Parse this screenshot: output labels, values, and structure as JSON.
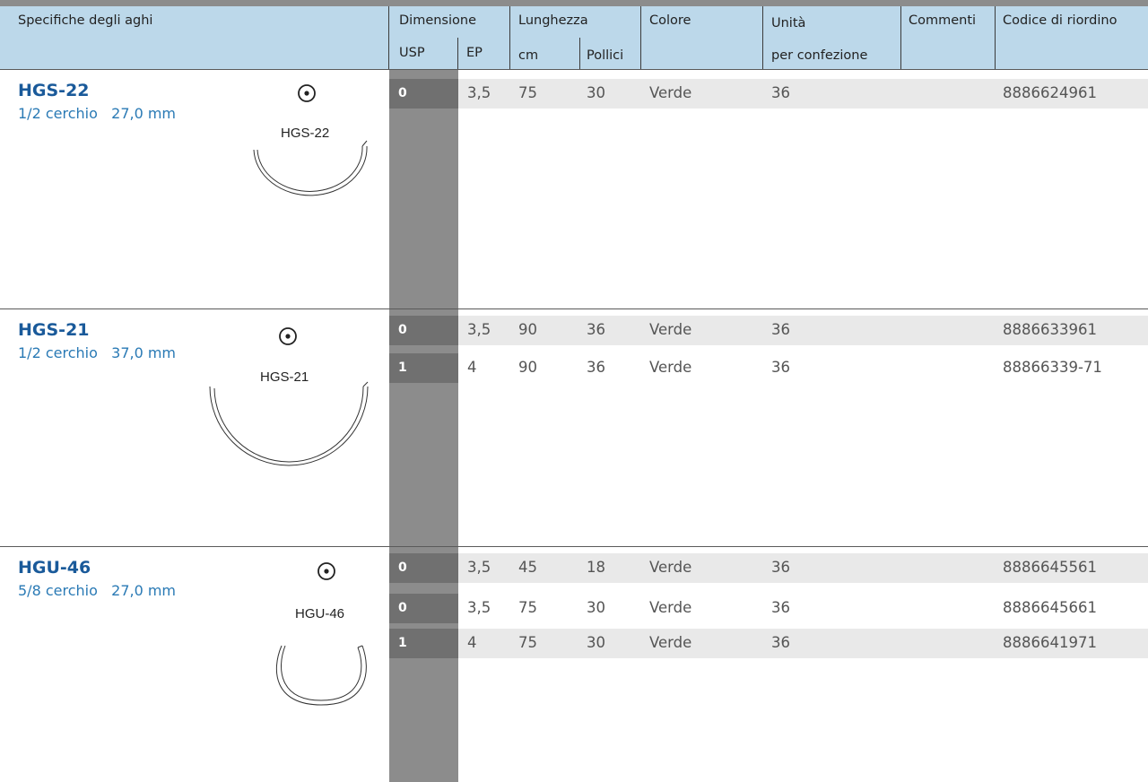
{
  "header": {
    "needle_spec": "Specifiche degli aghi",
    "size": "Dimensione",
    "usp": "USP",
    "ep": "EP",
    "length": "Lunghezza",
    "cm": "cm",
    "inches": "Pollici",
    "color": "Colore",
    "units": "Unità",
    "per_pack": "per confezione",
    "comments": "Commenti",
    "reorder_code": "Codice di riordino"
  },
  "groups": [
    {
      "name": "HGS-22",
      "spec": "1/2 cerchio   27,0 mm",
      "label": "HGS-22",
      "icon": "round-body-needle-icon",
      "curve": "1/2 circle",
      "rows": [
        {
          "usp": "0",
          "ep": "3,5",
          "cm": "75",
          "inches": "30",
          "color": "Verde",
          "units": "36",
          "comments": "",
          "code": "8886624961"
        }
      ]
    },
    {
      "name": "HGS-21",
      "spec": "1/2 cerchio   37,0 mm",
      "label": "HGS-21",
      "icon": "round-body-needle-icon",
      "curve": "1/2 circle",
      "rows": [
        {
          "usp": "0",
          "ep": "3,5",
          "cm": "90",
          "inches": "36",
          "color": "Verde",
          "units": "36",
          "comments": "",
          "code": "8886633961"
        },
        {
          "usp": "1",
          "ep": "4",
          "cm": "90",
          "inches": "36",
          "color": "Verde",
          "units": "36",
          "comments": "",
          "code": "88866339-71"
        }
      ]
    },
    {
      "name": "HGU-46",
      "spec": "5/8 cerchio   27,0 mm",
      "label": "HGU-46",
      "icon": "round-body-needle-icon",
      "curve": "5/8 circle",
      "rows": [
        {
          "usp": "0",
          "ep": "3,5",
          "cm": "45",
          "inches": "18",
          "color": "Verde",
          "units": "36",
          "comments": "",
          "code": "8886645561"
        },
        {
          "usp": "0",
          "ep": "3,5",
          "cm": "75",
          "inches": "30",
          "color": "Verde",
          "units": "36",
          "comments": "",
          "code": "8886645661"
        },
        {
          "usp": "1",
          "ep": "4",
          "cm": "75",
          "inches": "30",
          "color": "Verde",
          "units": "36",
          "comments": "",
          "code": "8886641971"
        }
      ]
    }
  ],
  "colors": {
    "header_bg": "#bcd8ea",
    "usp_column": "#8c8c8c",
    "usp_cell": "#707070",
    "row_band": "#e9e9e9",
    "needle_name": "#1a5a9a",
    "needle_spec": "#2a7ab5"
  }
}
